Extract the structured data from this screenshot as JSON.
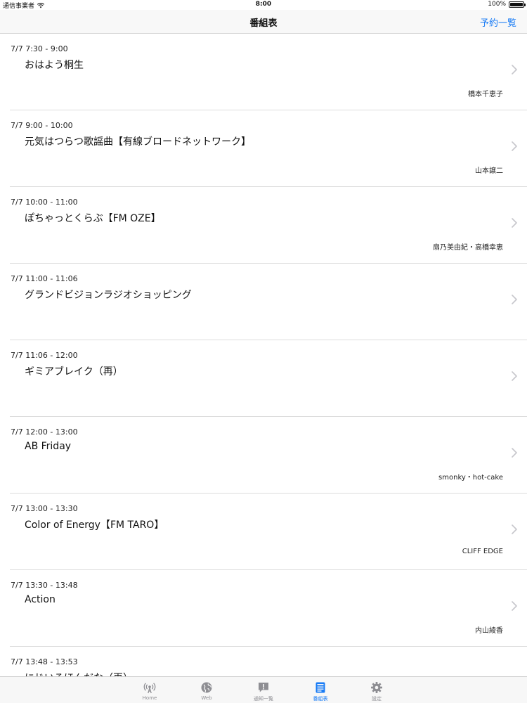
{
  "status_bar": {
    "carrier": "通信事業者",
    "time": "8:00",
    "battery": "100%",
    "battery_level": 1.0
  },
  "nav": {
    "title": "番組表",
    "right_button": "予約一覧"
  },
  "programs": [
    {
      "time": "7/7 7:30 - 9:00",
      "title": "おはよう桐生",
      "host": "橋本千恵子"
    },
    {
      "time": "7/7 9:00 - 10:00",
      "title": "元気はつらつ歌謡曲【有線ブロードネットワーク】",
      "host": "山本譲二"
    },
    {
      "time": "7/7 10:00 - 11:00",
      "title": "ぽちゃっとくらぶ【FM OZE】",
      "host": "扇乃美由紀・高橋幸恵"
    },
    {
      "time": "7/7 11:00 - 11:06",
      "title": "グランドビジョンラジオショッピング",
      "host": ""
    },
    {
      "time": "7/7 11:06 - 12:00",
      "title": "ギミアブレイク（再）",
      "host": ""
    },
    {
      "time": "7/7 12:00 - 13:00",
      "title": "AB Friday",
      "host": "smonky・hot-cake"
    },
    {
      "time": "7/7 13:00 - 13:30",
      "title": "Color of Energy【FM TARO】",
      "host": "CLIFF EDGE"
    },
    {
      "time": "7/7 13:30 - 13:48",
      "title": "Action",
      "host": "内山綾香"
    },
    {
      "time": "7/7 13:48 - 13:53",
      "title": "にじいろほんだな（再）",
      "host": ""
    }
  ],
  "tabs": [
    {
      "label": "Home",
      "icon": "radio-tower-icon",
      "active": false
    },
    {
      "label": "Web",
      "icon": "globe-icon",
      "active": false
    },
    {
      "label": "通知一覧",
      "icon": "notice-icon",
      "active": false
    },
    {
      "label": "番組表",
      "icon": "schedule-icon",
      "active": true
    },
    {
      "label": "設定",
      "icon": "gear-icon",
      "active": false
    }
  ],
  "colors": {
    "accent": "#1a7cf5",
    "inactive": "#8e8e93"
  }
}
